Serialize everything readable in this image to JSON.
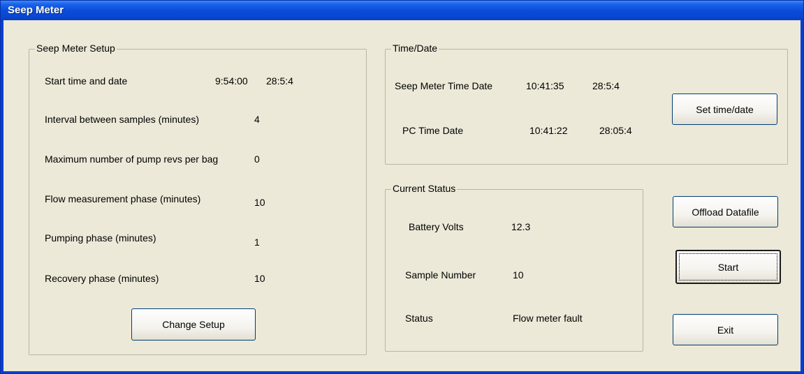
{
  "window": {
    "title": "Seep Meter"
  },
  "setup": {
    "title": "Seep Meter Setup",
    "start_label": "Start time and date",
    "start_time": "9:54:00",
    "start_date": "28:5:4",
    "interval_label": "Interval between samples (minutes)",
    "interval_value": "4",
    "maxrevs_label": "Maximum number of pump revs per bag",
    "maxrevs_value": "0",
    "flow_label": "Flow measurement phase (minutes)",
    "flow_value": "10",
    "pumping_label": "Pumping phase (minutes)",
    "pumping_value": "1",
    "recovery_label": "Recovery phase (minutes)",
    "recovery_value": "10",
    "change_button": "Change Setup"
  },
  "timedate": {
    "title": "Time/Date",
    "meter_label": "Seep Meter Time Date",
    "meter_time": "10:41:35",
    "meter_date": "28:5:4",
    "pc_label": "PC Time Date",
    "pc_time": "10:41:22",
    "pc_date": "28:05:4",
    "set_button": "Set time/date"
  },
  "status": {
    "title": "Current Status",
    "battery_label": "Battery Volts",
    "battery_value": "12.3",
    "sample_label": "Sample Number",
    "sample_value": "10",
    "status_label": "Status",
    "status_value": "Flow meter fault"
  },
  "buttons": {
    "offload": "Offload Datafile",
    "start": "Start",
    "exit": "Exit"
  }
}
